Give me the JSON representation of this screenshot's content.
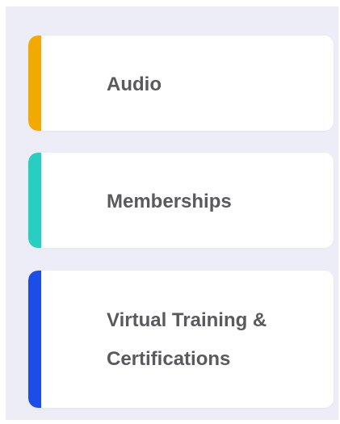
{
  "categories": [
    {
      "label": "Audio",
      "accent_color": "#f2a900"
    },
    {
      "label": "Memberships",
      "accent_color": "#26cfbf"
    },
    {
      "label": "Virtual Training & Certifications",
      "accent_color": "#1c4de8"
    }
  ]
}
